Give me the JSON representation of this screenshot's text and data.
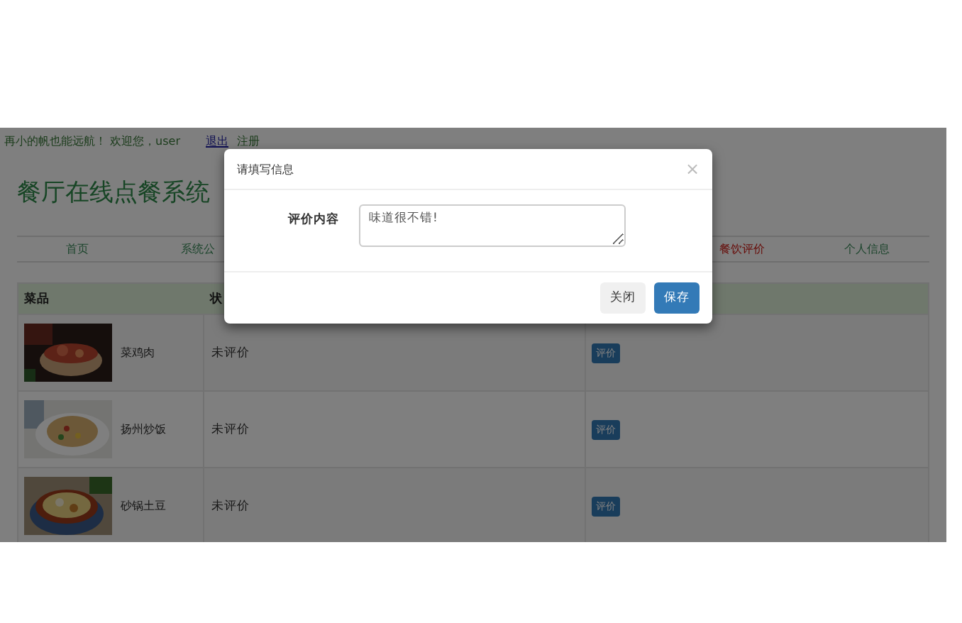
{
  "top_bar": {
    "slogan": "再小的帆也能远航！ 欢迎您，user",
    "links": [
      {
        "label": "退出",
        "kind": "visited"
      },
      {
        "label": "注册",
        "kind": "plain"
      }
    ]
  },
  "site_title": "餐厅在线点餐系统",
  "nav": {
    "left": [
      {
        "label": "首页",
        "selected": false
      },
      {
        "label": "系统公",
        "selected": false
      }
    ],
    "right": [
      {
        "label": "餐饮评价",
        "selected": true
      },
      {
        "label": "个人信息",
        "selected": false
      }
    ]
  },
  "table": {
    "columns": [
      "菜品",
      "状"
    ],
    "rows": [
      {
        "dish": "菜鸡肉",
        "status": "未评价",
        "action": "评价"
      },
      {
        "dish": "扬州炒饭",
        "status": "未评价",
        "action": "评价"
      },
      {
        "dish": "砂锅土豆",
        "status": "未评价",
        "action": "评价"
      }
    ]
  },
  "modal": {
    "title": "请填写信息",
    "close": "×",
    "field_label": "评价内容",
    "field_value": "味道很不错!",
    "buttons": [
      {
        "label": "关闭",
        "kind": "default"
      },
      {
        "label": "保存",
        "kind": "primary"
      }
    ]
  }
}
